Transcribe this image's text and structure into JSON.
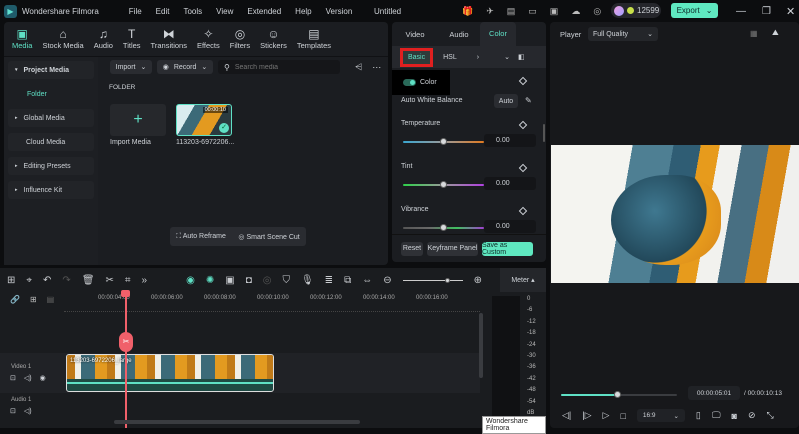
{
  "app": {
    "name": "Wondershare Filmora",
    "project": "Untitled",
    "credits": "12599",
    "export": "Export"
  },
  "menu": [
    "File",
    "Edit",
    "Tools",
    "View",
    "Extended",
    "Help",
    "Version"
  ],
  "toolbar": [
    {
      "label": "Media",
      "icon": "media-icon"
    },
    {
      "label": "Stock Media",
      "icon": "stock-media-icon"
    },
    {
      "label": "Audio",
      "icon": "music-icon"
    },
    {
      "label": "Titles",
      "icon": "text-icon"
    },
    {
      "label": "Transitions",
      "icon": "transitions-icon"
    },
    {
      "label": "Effects",
      "icon": "effects-icon"
    },
    {
      "label": "Filters",
      "icon": "filters-icon"
    },
    {
      "label": "Stickers",
      "icon": "stickers-icon"
    },
    {
      "label": "Templates",
      "icon": "templates-icon"
    }
  ],
  "sidebar": {
    "items": [
      "Project Media",
      "Folder",
      "Global Media",
      "Cloud Media",
      "Editing Presets",
      "Influence Kit"
    ]
  },
  "media": {
    "import": "Import",
    "record": "Record",
    "search_placeholder": "Search media",
    "folder": "FOLDER",
    "import_media": "Import Media",
    "clip_name": "113203-6972206...",
    "clip_duration": "00:00:10",
    "auto_reframe": "Auto Reframe",
    "smart_scene_cut": "Smart Scene Cut"
  },
  "color_panel": {
    "tabs": [
      "Video",
      "Audio",
      "Color"
    ],
    "subtabs": [
      "Basic",
      "HSL"
    ],
    "toggle": "Color",
    "awb": "Auto White Balance",
    "auto": "Auto",
    "sliders": [
      {
        "label": "Temperature",
        "value": "0.00",
        "pos": 0.5
      },
      {
        "label": "Tint",
        "value": "0.00",
        "pos": 0.5
      },
      {
        "label": "Vibrance",
        "value": "0.00",
        "pos": 0.5
      }
    ],
    "reset": "Reset",
    "keyframe": "Keyframe Panel",
    "save": "Save as Custom"
  },
  "player": {
    "label": "Player",
    "quality": "Full Quality",
    "current": "00:00:05:01",
    "total": "/ 00:00:10:13",
    "progress": 0.49,
    "ratio": "16:9"
  },
  "timeline": {
    "ruler": [
      "00:00:04:00",
      "00:00:06:00",
      "00:00:08:00",
      "00:00:10:00",
      "00:00:12:00",
      "00:00:14:00",
      "00:00:16:00"
    ],
    "meter": "Meter",
    "meter_scale": [
      "0",
      "-6",
      "-12",
      "-18",
      "-24",
      "-30",
      "-36",
      "-42",
      "-48",
      "-54",
      "dB"
    ],
    "video_track": "Video 1",
    "audio_track": "Audio 1",
    "clip_label": "113203-6972206_large",
    "tooltip": "Wondershare Filmora",
    "zoom": 0.75
  },
  "colors": {
    "accent": "#5fe0c5",
    "playhead": "#f0606a"
  }
}
